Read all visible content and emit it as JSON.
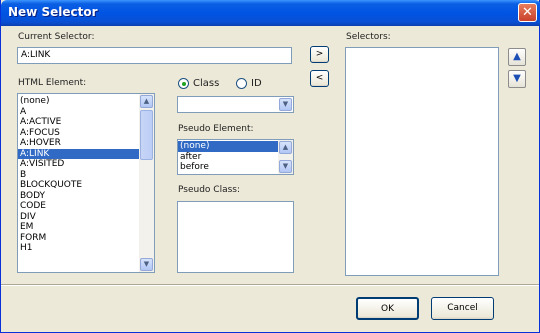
{
  "window": {
    "title": "New Selector",
    "close_glyph": "✕"
  },
  "current_selector": {
    "label": "Current Selector:",
    "value": "A:LINK"
  },
  "transfer": {
    "add_label": ">",
    "remove_label": "<"
  },
  "selectors": {
    "label": "Selectors:",
    "up_icon": "▲",
    "down_icon": "▼"
  },
  "html_element": {
    "label": "HTML Element:",
    "items": [
      "(none)",
      "A",
      "A:ACTIVE",
      "A:FOCUS",
      "A:HOVER",
      "A:LINK",
      "A:VISITED",
      "B",
      "BLOCKQUOTE",
      "BODY",
      "CODE",
      "DIV",
      "EM",
      "FORM",
      "H1"
    ],
    "selected_index": 5
  },
  "scope": {
    "class_label": "Class",
    "id_label": "ID",
    "selected": "class"
  },
  "class_combo": {
    "value": ""
  },
  "pseudo_element": {
    "label": "Pseudo Element:",
    "items": [
      "(none)",
      "after",
      "before"
    ],
    "selected_index": 0
  },
  "pseudo_class": {
    "label": "Pseudo Class:"
  },
  "footer": {
    "ok_label": "OK",
    "cancel_label": "Cancel"
  },
  "colors": {
    "titlebar": "#0054e3",
    "selection": "#316ac5",
    "dialog_bg": "#ece9d8"
  }
}
